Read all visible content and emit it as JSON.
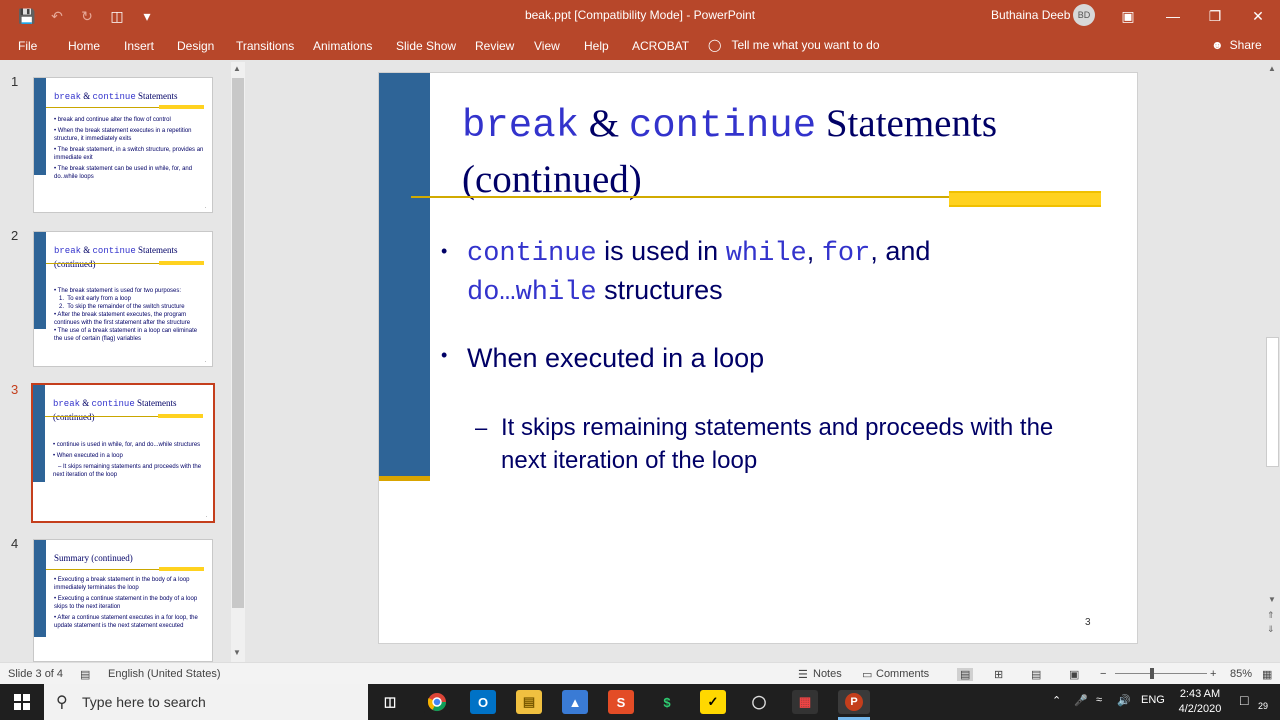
{
  "app": {
    "window_title": "beak.ppt  [Compatibility Mode]  -  PowerPoint",
    "user": "Buthaina Deeb",
    "user_initials": "BD"
  },
  "ribbon": {
    "tabs": [
      "File",
      "Home",
      "Insert",
      "Design",
      "Transitions",
      "Animations",
      "Slide Show",
      "Review",
      "View",
      "Help",
      "ACROBAT"
    ],
    "tell_me": "Tell me what you want to do",
    "share": "Share"
  },
  "thumbnails": [
    {
      "num": "1",
      "title_a": "break",
      "title_b": " & ",
      "title_c": "continue",
      "title_d": " Statements",
      "title_e": "",
      "bullets": [
        "• break and continue alter the flow of control",
        "• When the break statement executes in a repetition structure, it immediately exits",
        "• The break statement, in a switch structure, provides an immediate exit",
        "• The break statement can be used in while, for, and do..while loops"
      ]
    },
    {
      "num": "2",
      "title_a": "break",
      "title_b": " & ",
      "title_c": "continue",
      "title_d": " Statements",
      "title_e": "(continued)",
      "bullets": [
        "• The break statement is used for two purposes:",
        "   1.  To exit early from a loop",
        "   2.  To skip the remainder of the switch structure",
        "• After the break statement executes, the program continues with the first statement after the structure",
        "• The use of a break statement in a loop can eliminate the use of certain (flag) variables"
      ]
    },
    {
      "num": "3",
      "title_a": "break",
      "title_b": " & ",
      "title_c": "continue",
      "title_d": " Statements",
      "title_e": "(continued)",
      "bullets": [
        "• continue is used in while, for, and do...while structures",
        "• When executed in a loop",
        "   – It skips remaining statements and proceeds with the next iteration of the loop"
      ]
    },
    {
      "num": "4",
      "title_a": "",
      "title_b": "",
      "title_c": "",
      "title_d": "Summary (continued)",
      "title_e": "",
      "bullets": [
        "• Executing a break statement in the body of a loop immediately terminates the loop",
        "• Executing a continue statement in the body of a loop skips to the next iteration",
        "• After a continue statement executes in a for loop, the update statement is the next statement executed"
      ]
    }
  ],
  "slide": {
    "title_kw1": "break",
    "title_amp": " & ",
    "title_kw2": "continue",
    "title_word": " Statements",
    "title_line2": "(continued)",
    "b1_kw": "continue",
    "b1_t1": " is used in ",
    "b1_kw2": "while",
    "b1_t2": ", ",
    "b1_kw3": "for",
    "b1_t3": ", and ",
    "b1_kw4": "do",
    "b1_t4": "…",
    "b1_kw5": "while",
    "b1_t5": " structures",
    "b2": "When executed in a loop",
    "sub": "It skips remaining statements and proceeds with the next iteration of the loop",
    "bullet": "•",
    "dash": "–",
    "number": "3"
  },
  "status": {
    "slide": "Slide 3 of 4",
    "lang": "English (United States)",
    "notes": "Notes",
    "comments": "Comments",
    "zoom": "85%"
  },
  "taskbar": {
    "search": "Type here to search",
    "lang": "ENG",
    "time": "2:43 AM",
    "date": "4/2/2020",
    "notif": "29"
  },
  "colors": {
    "accent": "#b7472a",
    "slide_bar": "#2e6497",
    "slide_gold": "#ffd21f",
    "slide_text": "#000066"
  }
}
